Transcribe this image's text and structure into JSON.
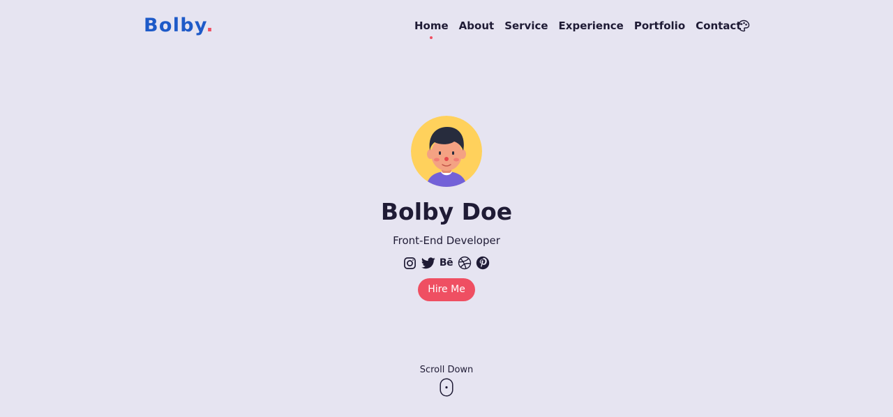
{
  "header": {
    "logo_text": "Bolby",
    "logo_dot": ".",
    "nav": [
      {
        "label": "Home",
        "active": true
      },
      {
        "label": "About"
      },
      {
        "label": "Service"
      },
      {
        "label": "Experience"
      },
      {
        "label": "Portfolio"
      },
      {
        "label": "Contact"
      }
    ],
    "theme_icon": "palette-icon"
  },
  "hero": {
    "name": "Bolby Doe",
    "role": "Front-End Developer",
    "socials": [
      "instagram-icon",
      "twitter-icon",
      "behance-icon",
      "dribbble-icon",
      "pinterest-icon"
    ],
    "behance_text": "Bē",
    "cta_label": "Hire Me",
    "scroll_label": "Scroll Down"
  },
  "colors": {
    "background": "#e6e4f1",
    "brand_blue": "#1e5ac8",
    "accent_red": "#ef4f62",
    "text_dark": "#1f1b35",
    "avatar_yellow": "#ffd15c"
  }
}
